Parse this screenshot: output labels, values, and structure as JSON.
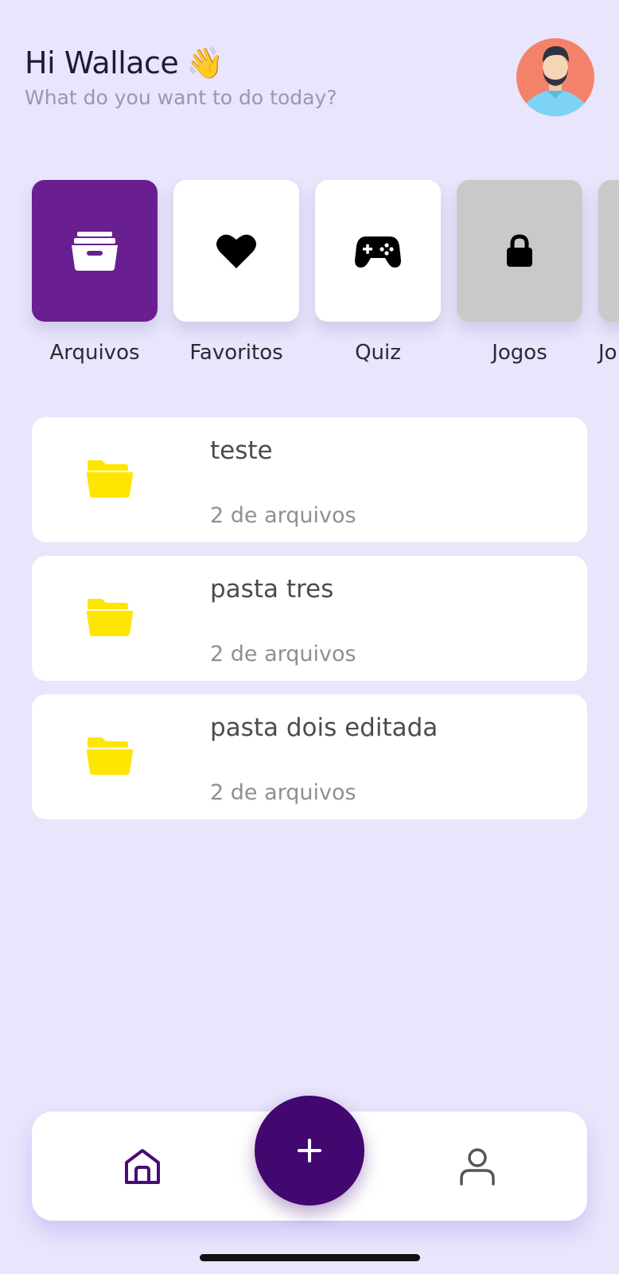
{
  "header": {
    "greeting": "Hi Wallace",
    "wave_emoji": "👋",
    "subtitle": "What do you want to do today?"
  },
  "categories": [
    {
      "label": "Arquivos",
      "icon": "archive-box-icon",
      "state": "active"
    },
    {
      "label": "Favoritos",
      "icon": "heart-icon",
      "state": "normal"
    },
    {
      "label": "Quiz",
      "icon": "gamepad-icon",
      "state": "normal"
    },
    {
      "label": "Jogos",
      "icon": "lock-icon",
      "state": "locked"
    },
    {
      "label": "Jo",
      "icon": "",
      "state": "locked"
    }
  ],
  "folders": [
    {
      "name": "teste",
      "count": "2 de arquivos"
    },
    {
      "name": "pasta tres",
      "count": "2 de arquivos"
    },
    {
      "name": "pasta dois editada",
      "count": "2 de arquivos"
    }
  ],
  "nav": {
    "items": [
      "home-icon",
      "plus-icon",
      "person-icon"
    ]
  },
  "colors": {
    "background": "#E8E5FC",
    "active_tile": "#6A1F90",
    "locked_tile": "#C9C9C9",
    "folder": "#FFE600",
    "fab": "#430770",
    "avatar_bg": "#F4826A"
  }
}
